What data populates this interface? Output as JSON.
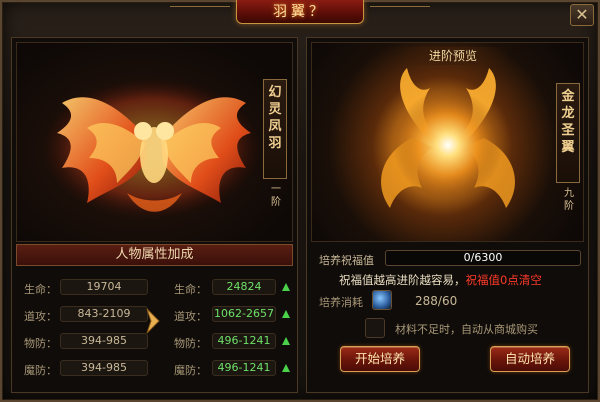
{
  "window": {
    "title": "羽翼？"
  },
  "current_wing": {
    "name": "幻灵凤羽",
    "stage": "一阶"
  },
  "attributes": {
    "header": "人物属性加成",
    "rows": [
      {
        "label": "生命：",
        "current": "19704",
        "next": "24824"
      },
      {
        "label": "道攻：",
        "current": "843-2109",
        "next": "1062-2657"
      },
      {
        "label": "物防：",
        "current": "394-985",
        "next": "496-1241"
      },
      {
        "label": "魔防：",
        "current": "394-985",
        "next": "496-1241"
      }
    ]
  },
  "preview": {
    "banner": "进阶预览",
    "name": "金龙圣翼",
    "stage": "九阶"
  },
  "cultivate": {
    "bless_label": "培养祝福值",
    "bless_current": 0,
    "bless_max": 6300,
    "bless_text": "0/6300",
    "tip_normal": "祝福值越高进阶越容易，",
    "tip_warning": "祝福值0点清空",
    "cost_label": "培养消耗",
    "cost_icon": "blue-gem-icon",
    "cost_value": "288/60",
    "auto_buy_text": "材料不足时，自动从商城购买",
    "start_button": "开始培养",
    "auto_button": "自动培养"
  },
  "colors": {
    "accent_gold": "#d8a050",
    "increase_green": "#6ee06a",
    "warning_red": "#ff3a2a",
    "button_red": "#9a2a18"
  }
}
